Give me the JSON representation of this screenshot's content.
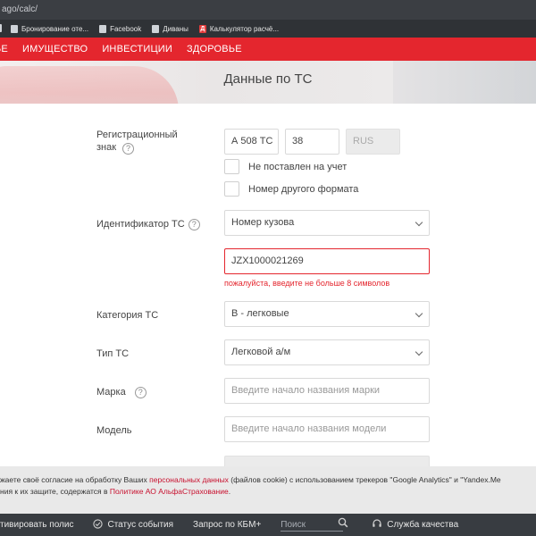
{
  "browser": {
    "url": "ago/calc/",
    "bookmarks": [
      {
        "icon": "page-icon",
        "label": "Бронирование оте..."
      },
      {
        "icon": "page-icon",
        "label": "Facebook"
      },
      {
        "icon": "page-icon",
        "label": "Диваны"
      },
      {
        "icon": "letter-d-icon",
        "icon_text": "Д",
        "label": "Калькулятор расчё..."
      }
    ]
  },
  "nav": {
    "items": [
      "ЬЕ",
      "ИМУЩЕСТВО",
      "ИНВЕСТИЦИИ",
      "ЗДОРОВЬЕ"
    ],
    "color": "#e4262e"
  },
  "hero": {
    "title": "Данные по ТС"
  },
  "form": {
    "reg_label": "Регистрационный знак",
    "help_glyph": "?",
    "reg_number": "А 508 ТС",
    "reg_region": "38",
    "reg_country": "RUS",
    "not_registered": "Не поставлен на учет",
    "other_format": "Номер другого формата",
    "id_label": "Идентификатор ТС",
    "id_type": "Номер кузова",
    "id_value": "JZX1000021269",
    "id_error": "пожалуйста, введите не больше 8 символов",
    "category_label": "Категория ТС",
    "category_value": "В - легковые",
    "type_label": "Тип ТС",
    "type_value": "Легковой а/м",
    "brand_label": "Марка",
    "brand_placeholder": "Введите начало названия марки",
    "model_label": "Модель",
    "model_placeholder": "Введите начало названия модели"
  },
  "cookie": {
    "line1_a": "жаете своё согласие на обработку Ваших ",
    "line1_link": "персональных данных",
    "line1_b": " (файлов cookie) с использованием трекеров \"Google Analytics\" и \"Yandex.Me",
    "line2_a": "ния к их защите, содержатся в ",
    "line2_link": "Политике АО АльфаСтрахование",
    "line2_b": "."
  },
  "bottom": {
    "activate": "тивировать полис",
    "status": "Статус события",
    "kbm": "Запрос по КБМ+",
    "search_placeholder": "Поиск",
    "quality": "Служба качества"
  }
}
